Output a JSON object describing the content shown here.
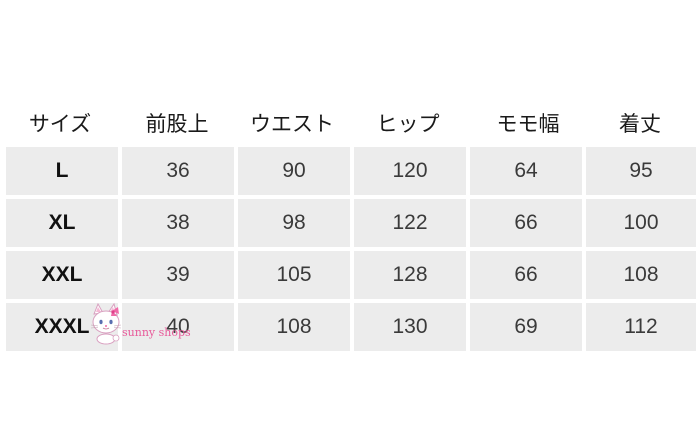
{
  "table": {
    "headers": [
      "サイズ",
      "前股上",
      "ウエスト",
      "ヒップ",
      "モモ幅",
      "着丈"
    ],
    "rows": [
      {
        "size": "L",
        "values": [
          "36",
          "90",
          "120",
          "64",
          "95"
        ]
      },
      {
        "size": "XL",
        "values": [
          "38",
          "98",
          "122",
          "66",
          "100"
        ]
      },
      {
        "size": "XXL",
        "values": [
          "39",
          "105",
          "128",
          "66",
          "108"
        ]
      },
      {
        "size": "XXXL",
        "values": [
          "40",
          "108",
          "130",
          "69",
          "112"
        ]
      }
    ]
  },
  "watermark": {
    "text": "sunny shops",
    "icon": "cat-logo-icon",
    "color": "#e85a9a"
  },
  "colors": {
    "cell_background": "#ececec",
    "page_background": "#ffffff"
  }
}
